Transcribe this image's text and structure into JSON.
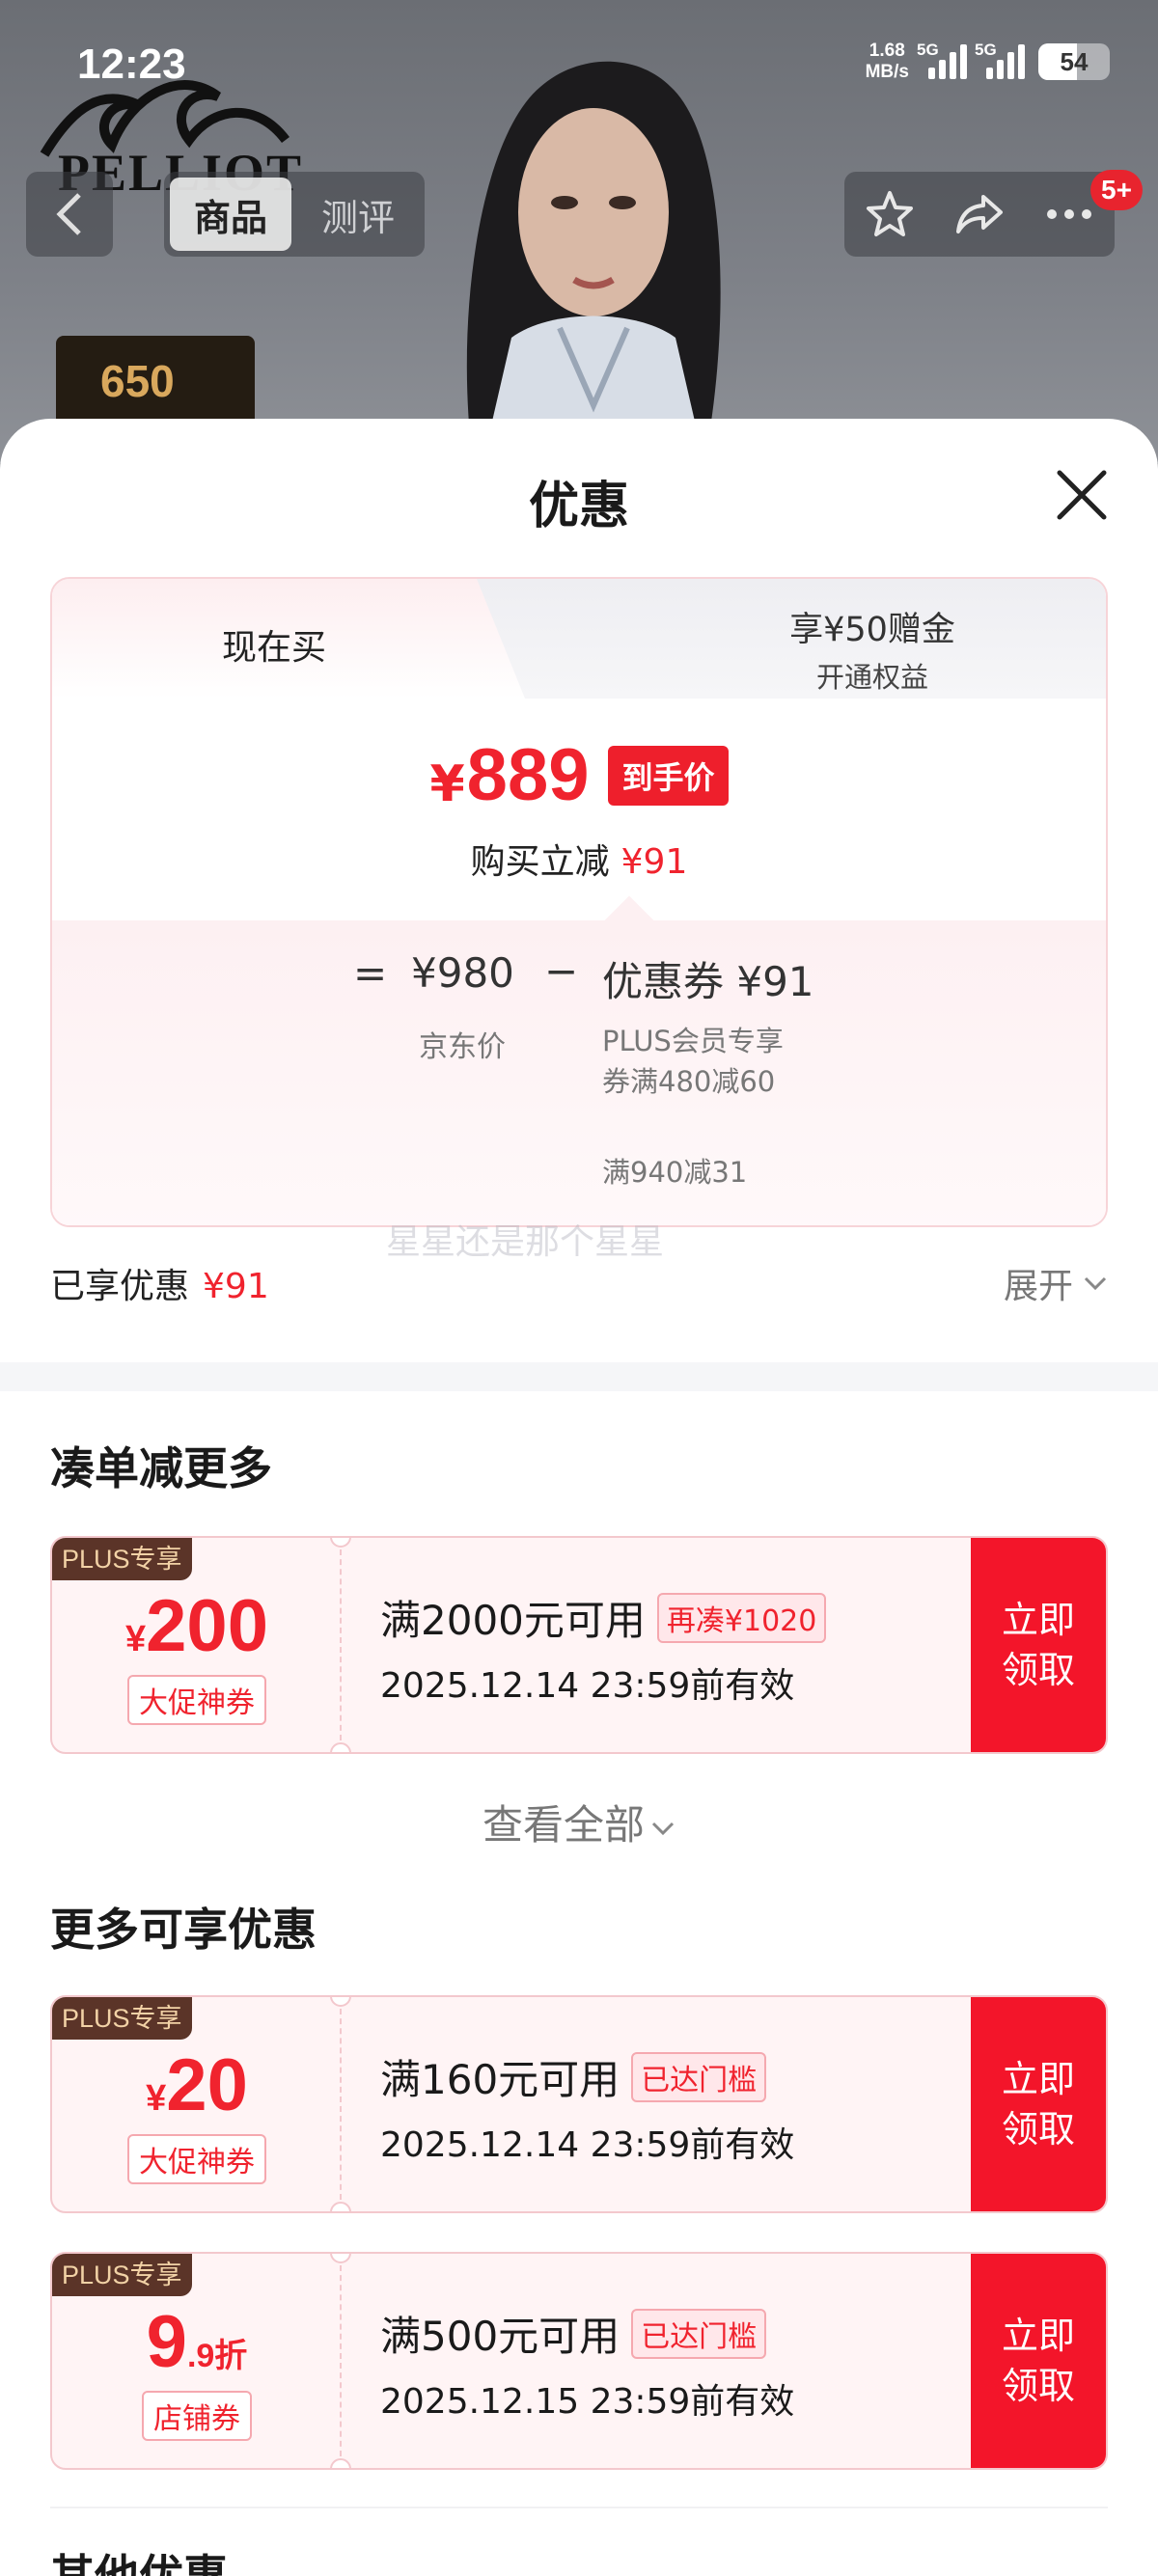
{
  "status": {
    "time": "12:23",
    "net_speed_top": "1.68",
    "net_speed_unit": "MB/s",
    "sim1": "5G",
    "sim2": "5G",
    "battery": "54"
  },
  "header": {
    "tabs": [
      "商品",
      "测评"
    ],
    "active_tab": 0,
    "notification_badge": "5+",
    "brand_text": "PELLIOT",
    "thumb_text": "650"
  },
  "sheet": {
    "title": "优惠",
    "tabs": {
      "left": "现在买",
      "right_line1": "享¥50赠金",
      "right_line2": "开通权益"
    },
    "final_price": {
      "currency": "¥",
      "value": "889",
      "badge": "到手价",
      "reduce_label": "购买立减",
      "reduce_value": "¥91"
    },
    "breakdown": {
      "equals": "=",
      "price": "¥980",
      "price_label": "京东价",
      "minus": "−",
      "coupon": "优惠券 ¥91",
      "coupon_detail": "PLUS会员专享券满480减60",
      "coupon_detail2": "满940减31"
    },
    "watermark": "星星还是那个星星",
    "enjoyed": {
      "label": "已享优惠",
      "value": "¥91",
      "expand": "展开"
    },
    "section1_title": "凑单减更多",
    "section2_title": "更多可享优惠",
    "section3_title": "其他优惠",
    "view_all": "查看全部"
  },
  "coupons": [
    {
      "tag": "PLUS专享",
      "currency": "¥",
      "amount": "200",
      "suffix": "",
      "type": "大促神券",
      "condition": "满2000元可用",
      "cond_tag": "再凑¥1020",
      "valid": "2025.12.14 23:59前有效",
      "claim": "立即领取"
    },
    {
      "tag": "PLUS专享",
      "currency": "¥",
      "amount": "20",
      "suffix": "",
      "type": "大促神券",
      "condition": "满160元可用",
      "cond_tag": "已达门槛",
      "valid": "2025.12.14 23:59前有效",
      "claim": "立即领取"
    },
    {
      "tag": "PLUS专享",
      "currency": "",
      "amount": "9",
      "suffix": ".9折",
      "type": "店铺券",
      "condition": "满500元可用",
      "cond_tag": "已达门槛",
      "valid": "2025.12.15 23:59前有效",
      "claim": "立即领取"
    }
  ],
  "colors": {
    "accent_red": "#f0232e",
    "claim_red": "#f3152a",
    "plus_brown": "#5b3428"
  }
}
